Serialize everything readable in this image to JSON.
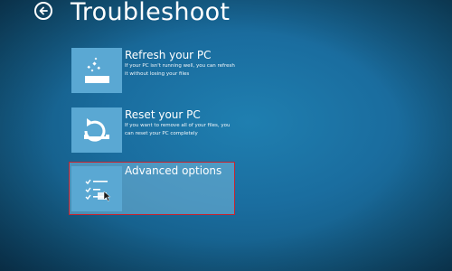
{
  "header": {
    "back_icon": "back-arrow-icon",
    "title": "Troubleshoot"
  },
  "options": [
    {
      "icon": "refresh-pc-icon",
      "title": "Refresh your PC",
      "description": "If your PC isn't running well, you can refresh it without losing your files"
    },
    {
      "icon": "reset-pc-icon",
      "title": "Reset your PC",
      "description": "If you want to remove all of your files, you can reset your PC completely"
    },
    {
      "icon": "advanced-options-icon",
      "title": "Advanced options",
      "description": ""
    }
  ],
  "colors": {
    "background": "#1a6d9f",
    "tile": "#5aa8d3",
    "selection_border": "#c8232e",
    "text": "#ffffff"
  }
}
